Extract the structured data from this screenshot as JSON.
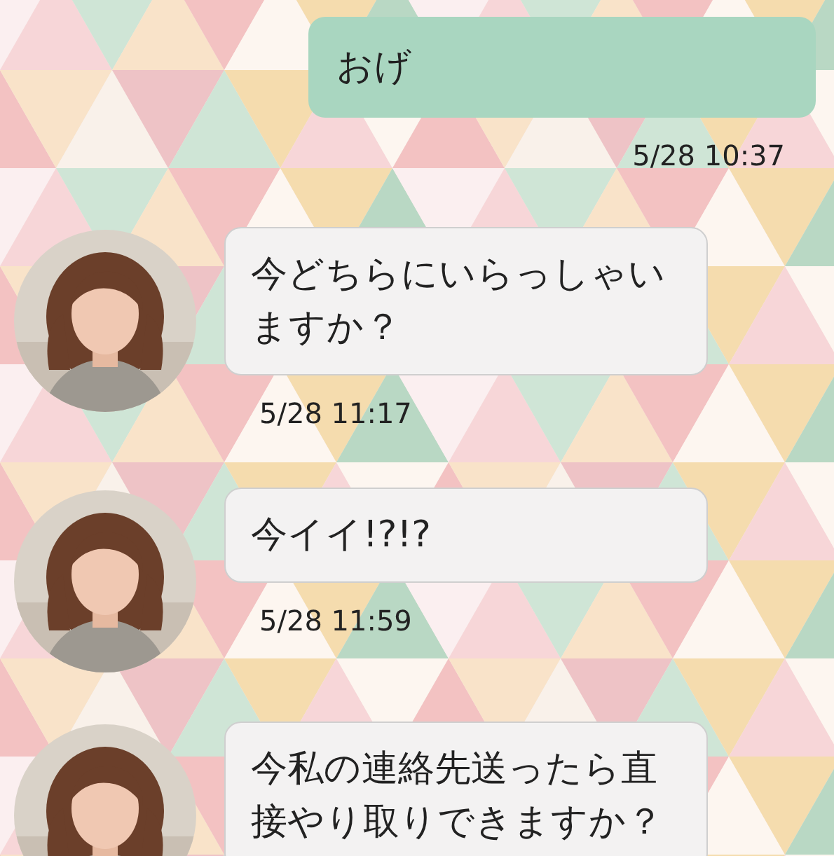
{
  "messages": [
    {
      "kind": "sent",
      "text": "おげ",
      "time": "5/28 10:37"
    },
    {
      "kind": "received",
      "text": "今どちらにいらっしゃいますか？",
      "time": "5/28 11:17"
    },
    {
      "kind": "received",
      "text": "今イイ!?!?",
      "time": "5/28 11:59"
    },
    {
      "kind": "received",
      "text": "今私の連絡先送ったら直接やり取りできますか？"
    }
  ]
}
